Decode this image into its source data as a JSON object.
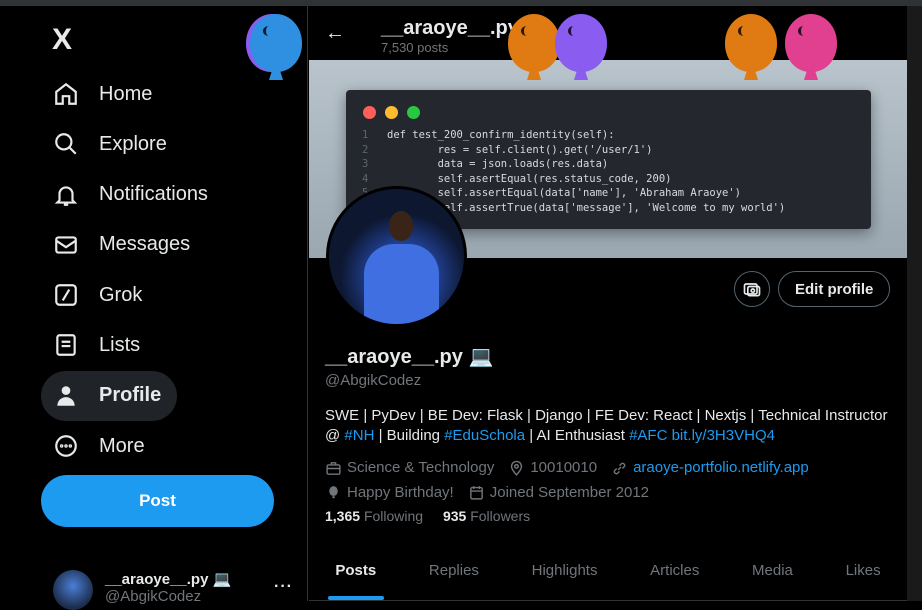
{
  "sidebar": {
    "logo": "X",
    "items": [
      {
        "label": "Home",
        "icon": "home-icon"
      },
      {
        "label": "Explore",
        "icon": "search-icon"
      },
      {
        "label": "Notifications",
        "icon": "bell-icon"
      },
      {
        "label": "Messages",
        "icon": "mail-icon"
      },
      {
        "label": "Grok",
        "icon": "grok-icon"
      },
      {
        "label": "Lists",
        "icon": "list-icon"
      },
      {
        "label": "Profile",
        "icon": "person-icon",
        "active": true
      },
      {
        "label": "More",
        "icon": "more-circle-icon"
      }
    ],
    "post_label": "Post",
    "account": {
      "name": "__araoye__.py 💻",
      "handle": "@AbgikCodez",
      "more": "···"
    }
  },
  "header": {
    "back": "←",
    "name": "__araoye__.py 💻",
    "posts": "7,530 posts"
  },
  "banner": {
    "code_lines": [
      {
        "n": "1",
        "code": "def test_200_confirm_identity(self):"
      },
      {
        "n": "2",
        "code": "        res = self.client().get('/user/1')"
      },
      {
        "n": "3",
        "code": "        data = json.loads(res.data)"
      },
      {
        "n": "4",
        "code": "        self.asertEqual(res.status_code, 200)"
      },
      {
        "n": "5",
        "code": "        self.assertEqual(data['name'], 'Abraham Araoye')"
      },
      {
        "n": "6",
        "code": "        self.assertTrue(data['message'], 'Welcome to my world')"
      }
    ]
  },
  "profile": {
    "edit_label": "Edit profile",
    "name": "__araoye__.py 💻",
    "handle": "@AbgikCodez",
    "bio": {
      "p1": "SWE | PyDev | BE Dev: Flask | Django | FE Dev: React | Nextjs | Technical Instructor @ ",
      "h1": "#NH",
      "p2": " | Building ",
      "h2": "#EduSchola",
      "p3": " | AI Enthusiast ",
      "h3": "#AFC",
      "p4": " ",
      "l1": "bit.ly/3H3VHQ4"
    },
    "category": "Science & Technology",
    "location": "10010010",
    "website": "araoye-portfolio.netlify.app",
    "birthday": "Happy Birthday!",
    "joined": "Joined September 2012",
    "following_count": "1,365",
    "following_label": "Following",
    "followers_count": "935",
    "followers_label": "Followers"
  },
  "tabs": [
    "Posts",
    "Replies",
    "Highlights",
    "Articles",
    "Media",
    "Likes"
  ],
  "colors": {
    "accent": "#1d9bf0",
    "balloons": [
      "#2f8fe0",
      "#e07a12",
      "#8a5cf0",
      "#e07a12",
      "#e0408f"
    ]
  }
}
